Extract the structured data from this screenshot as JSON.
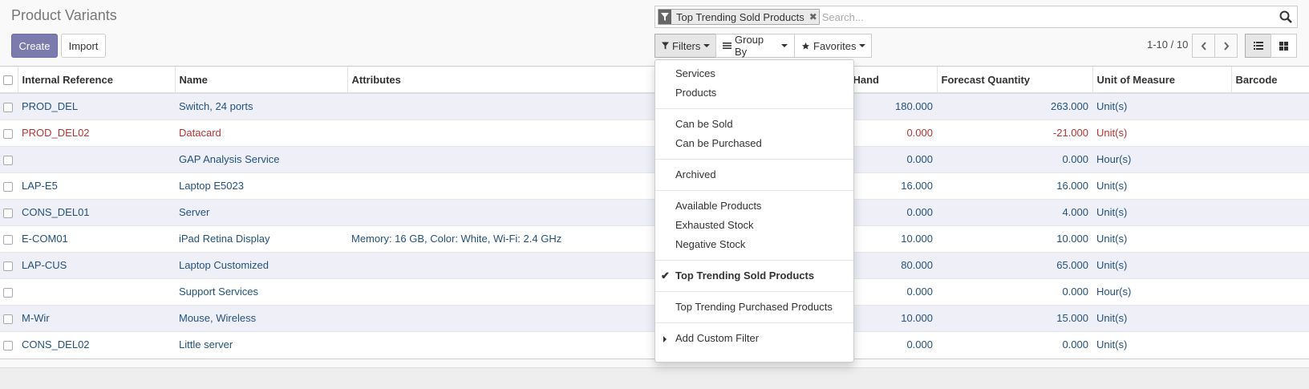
{
  "header": {
    "title": "Product Variants",
    "create_label": "Create",
    "import_label": "Import"
  },
  "search": {
    "facet_label": "Top Trending Sold Products",
    "placeholder": "Search..."
  },
  "search_view": {
    "filters_label": "Filters",
    "groupby_label": "Group By",
    "favorites_label": "Favorites"
  },
  "pager": {
    "value": "1-10 / 10"
  },
  "table": {
    "columns": {
      "ref": "Internal Reference",
      "name": "Name",
      "attributes": "Attributes",
      "onhand": "Hand",
      "forecast": "Forecast Quantity",
      "uom": "Unit of Measure",
      "barcode": "Barcode"
    },
    "rows": [
      {
        "ref": "PROD_DEL",
        "name": "Switch, 24 ports",
        "attributes": "",
        "onhand": "180.000",
        "forecast": "263.000",
        "uom": "Unit(s)",
        "barcode": ""
      },
      {
        "ref": "PROD_DEL02",
        "name": "Datacard",
        "attributes": "",
        "onhand": "0.000",
        "forecast": "-21.000",
        "uom": "Unit(s)",
        "barcode": ""
      },
      {
        "ref": "",
        "name": "GAP Analysis Service",
        "attributes": "",
        "onhand": "0.000",
        "forecast": "0.000",
        "uom": "Hour(s)",
        "barcode": ""
      },
      {
        "ref": "LAP-E5",
        "name": "Laptop E5023",
        "attributes": "",
        "onhand": "16.000",
        "forecast": "16.000",
        "uom": "Unit(s)",
        "barcode": ""
      },
      {
        "ref": "CONS_DEL01",
        "name": "Server",
        "attributes": "",
        "onhand": "0.000",
        "forecast": "4.000",
        "uom": "Unit(s)",
        "barcode": ""
      },
      {
        "ref": "E-COM01",
        "name": "iPad Retina Display",
        "attributes": "Memory: 16 GB, Color: White, Wi-Fi: 2.4 GHz",
        "onhand": "10.000",
        "forecast": "10.000",
        "uom": "Unit(s)",
        "barcode": ""
      },
      {
        "ref": "LAP-CUS",
        "name": "Laptop Customized",
        "attributes": "",
        "onhand": "80.000",
        "forecast": "65.000",
        "uom": "Unit(s)",
        "barcode": ""
      },
      {
        "ref": "",
        "name": "Support Services",
        "attributes": "",
        "onhand": "0.000",
        "forecast": "0.000",
        "uom": "Hour(s)",
        "barcode": ""
      },
      {
        "ref": "M-Wir",
        "name": "Mouse, Wireless",
        "attributes": "",
        "onhand": "10.000",
        "forecast": "15.000",
        "uom": "Unit(s)",
        "barcode": ""
      },
      {
        "ref": "CONS_DEL02",
        "name": "Little server",
        "attributes": "",
        "onhand": "0.000",
        "forecast": "0.000",
        "uom": "Unit(s)",
        "barcode": ""
      }
    ]
  },
  "filters_menu": {
    "services": "Services",
    "products": "Products",
    "can_be_sold": "Can be Sold",
    "can_be_purchased": "Can be Purchased",
    "archived": "Archived",
    "available_products": "Available Products",
    "exhausted_stock": "Exhausted Stock",
    "negative_stock": "Negative Stock",
    "top_sold": "Top Trending Sold Products",
    "top_purchased": "Top Trending Purchased Products",
    "add_custom": "Add Custom Filter"
  },
  "colors": {
    "primary": "#7c7bad",
    "link": "#23527c",
    "danger": "#b33333",
    "row_stripe": "#eeeff7"
  }
}
